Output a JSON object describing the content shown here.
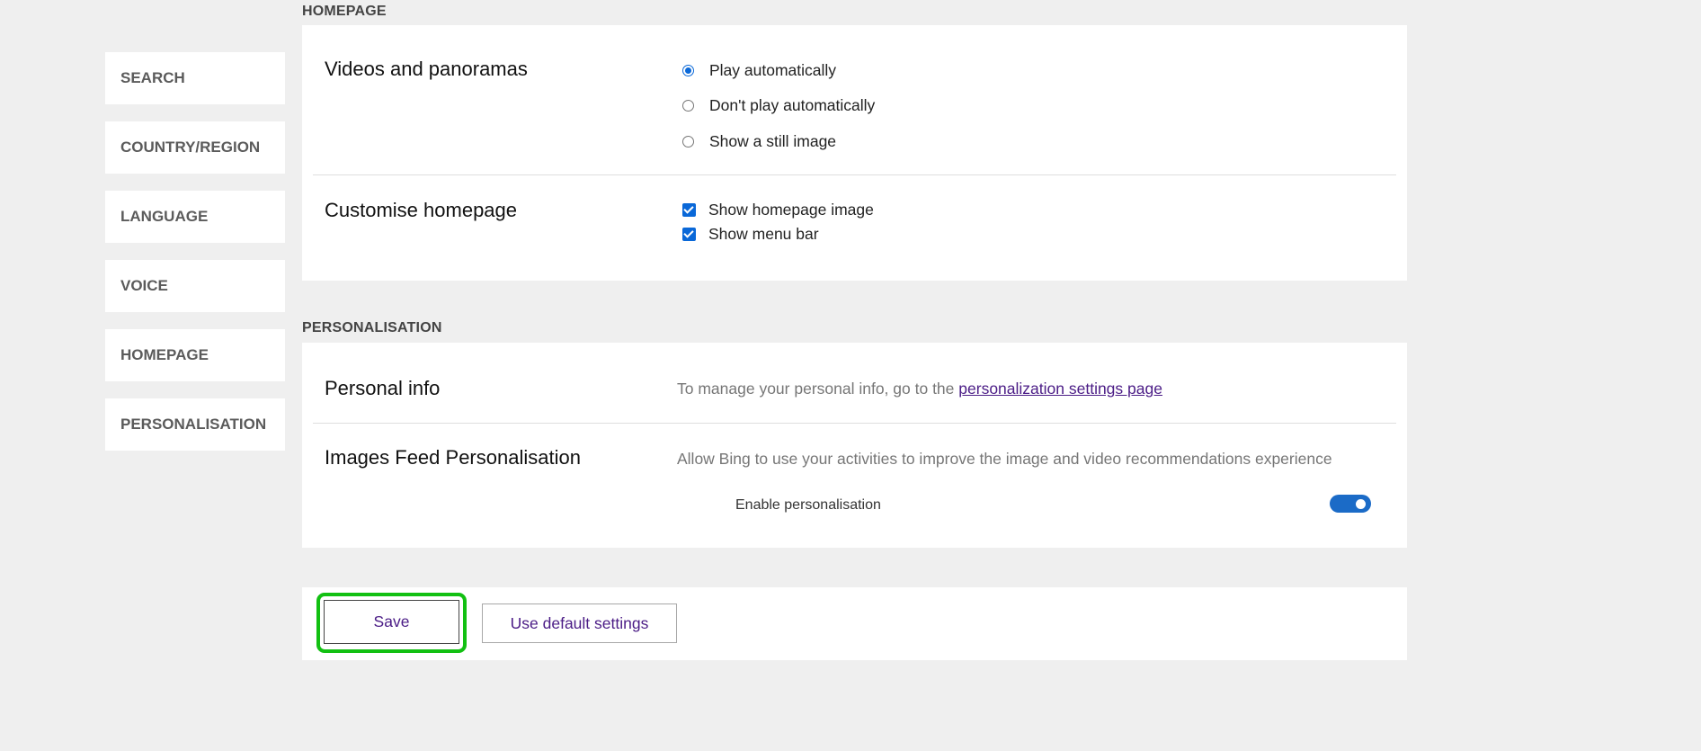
{
  "sidebar": {
    "items": [
      {
        "label": "SEARCH"
      },
      {
        "label": "COUNTRY/REGION"
      },
      {
        "label": "LANGUAGE"
      },
      {
        "label": "VOICE"
      },
      {
        "label": "HOMEPAGE"
      },
      {
        "label": "PERSONALISATION"
      }
    ]
  },
  "homepage": {
    "title": "HOMEPAGE",
    "videos": {
      "label": "Videos and panoramas",
      "options": [
        {
          "label": "Play automatically",
          "selected": true
        },
        {
          "label": "Don't play automatically",
          "selected": false
        },
        {
          "label": "Show a still image",
          "selected": false
        }
      ]
    },
    "customise": {
      "label": "Customise homepage",
      "options": [
        {
          "label": "Show homepage image",
          "checked": true
        },
        {
          "label": "Show menu bar",
          "checked": true
        }
      ]
    }
  },
  "personalisation": {
    "title": "PERSONALISATION",
    "personal_info": {
      "label": "Personal info",
      "text": "To manage your personal info, go to the",
      "link": "personalization settings page"
    },
    "images_feed": {
      "label": "Images Feed Personalisation",
      "text": "Allow Bing to use your activities to improve the image and video recommendations experience",
      "toggle_label": "Enable personalisation",
      "toggle_on": true
    }
  },
  "actions": {
    "save_label": "Save",
    "default_label": "Use default settings"
  },
  "colors": {
    "accent": "#0a68d8",
    "link": "#4b1c86",
    "highlight": "#12c012",
    "background": "#efefef"
  }
}
